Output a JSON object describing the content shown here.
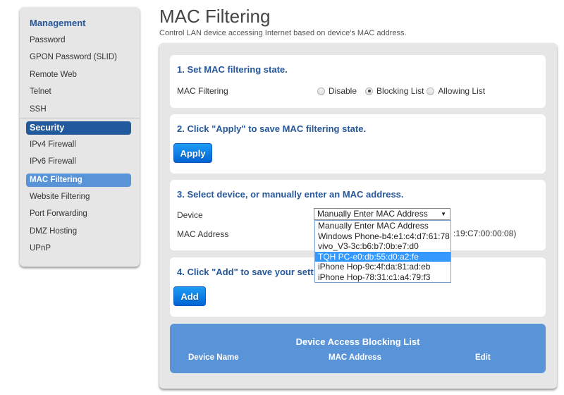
{
  "sidebar": {
    "sections": [
      {
        "heading": "Management",
        "items": [
          "Password",
          "GPON Password (SLID)",
          "Remote Web",
          "Telnet",
          "SSH"
        ]
      },
      {
        "heading": "Security",
        "items": [
          "IPv4 Firewall",
          "IPv6 Firewall",
          "MAC Filtering",
          "Website Filtering",
          "Port Forwarding",
          "DMZ Hosting",
          "UPnP"
        ],
        "active_item": "MAC Filtering"
      }
    ]
  },
  "header": {
    "title": "MAC Filtering",
    "subtitle": "Control LAN device accessing Internet based on device's MAC address."
  },
  "step1": {
    "title": "1. Set MAC filtering state.",
    "field_label": "MAC Filtering",
    "options": [
      "Disable",
      "Blocking List",
      "Allowing List"
    ],
    "selected": "Blocking List"
  },
  "step2": {
    "title": "2. Click \"Apply\" to save MAC filtering state.",
    "button": "Apply"
  },
  "step3": {
    "title": "3. Select device, or manually enter an MAC address.",
    "device_label": "Device",
    "device_value": "Manually Enter MAC Address",
    "mac_label": "MAC Address",
    "mac_hint_visible": ":19:C7:00:00:08)",
    "dropdown_options": [
      "Manually Enter MAC Address",
      "Windows Phone-b4:e1:c4:d7:61:78",
      "vivo_V3-3c:b6:b7:0b:e7:d0",
      "TQH PC-e0:db:55:d0:a2:fe",
      "iPhone Hop-9c:4f:da:81:ad:eb",
      "iPhone Hop-78:31:c1:a4:79:f3"
    ],
    "highlighted_option": "TQH PC-e0:db:55:d0:a2:fe"
  },
  "step4": {
    "title_visible": "4. Click \"Add\" to save your sett",
    "button": "Add"
  },
  "blocking_list": {
    "title": "Device Access Blocking List",
    "columns": [
      "Device Name",
      "MAC Address",
      "Edit"
    ],
    "rows": []
  },
  "colors": {
    "heading_blue": "#26579a",
    "active_dark": "#22589c",
    "active_light": "#5a94d8",
    "button_blue": "#0a7ae6",
    "panel_gray": "#e6e6e6"
  }
}
